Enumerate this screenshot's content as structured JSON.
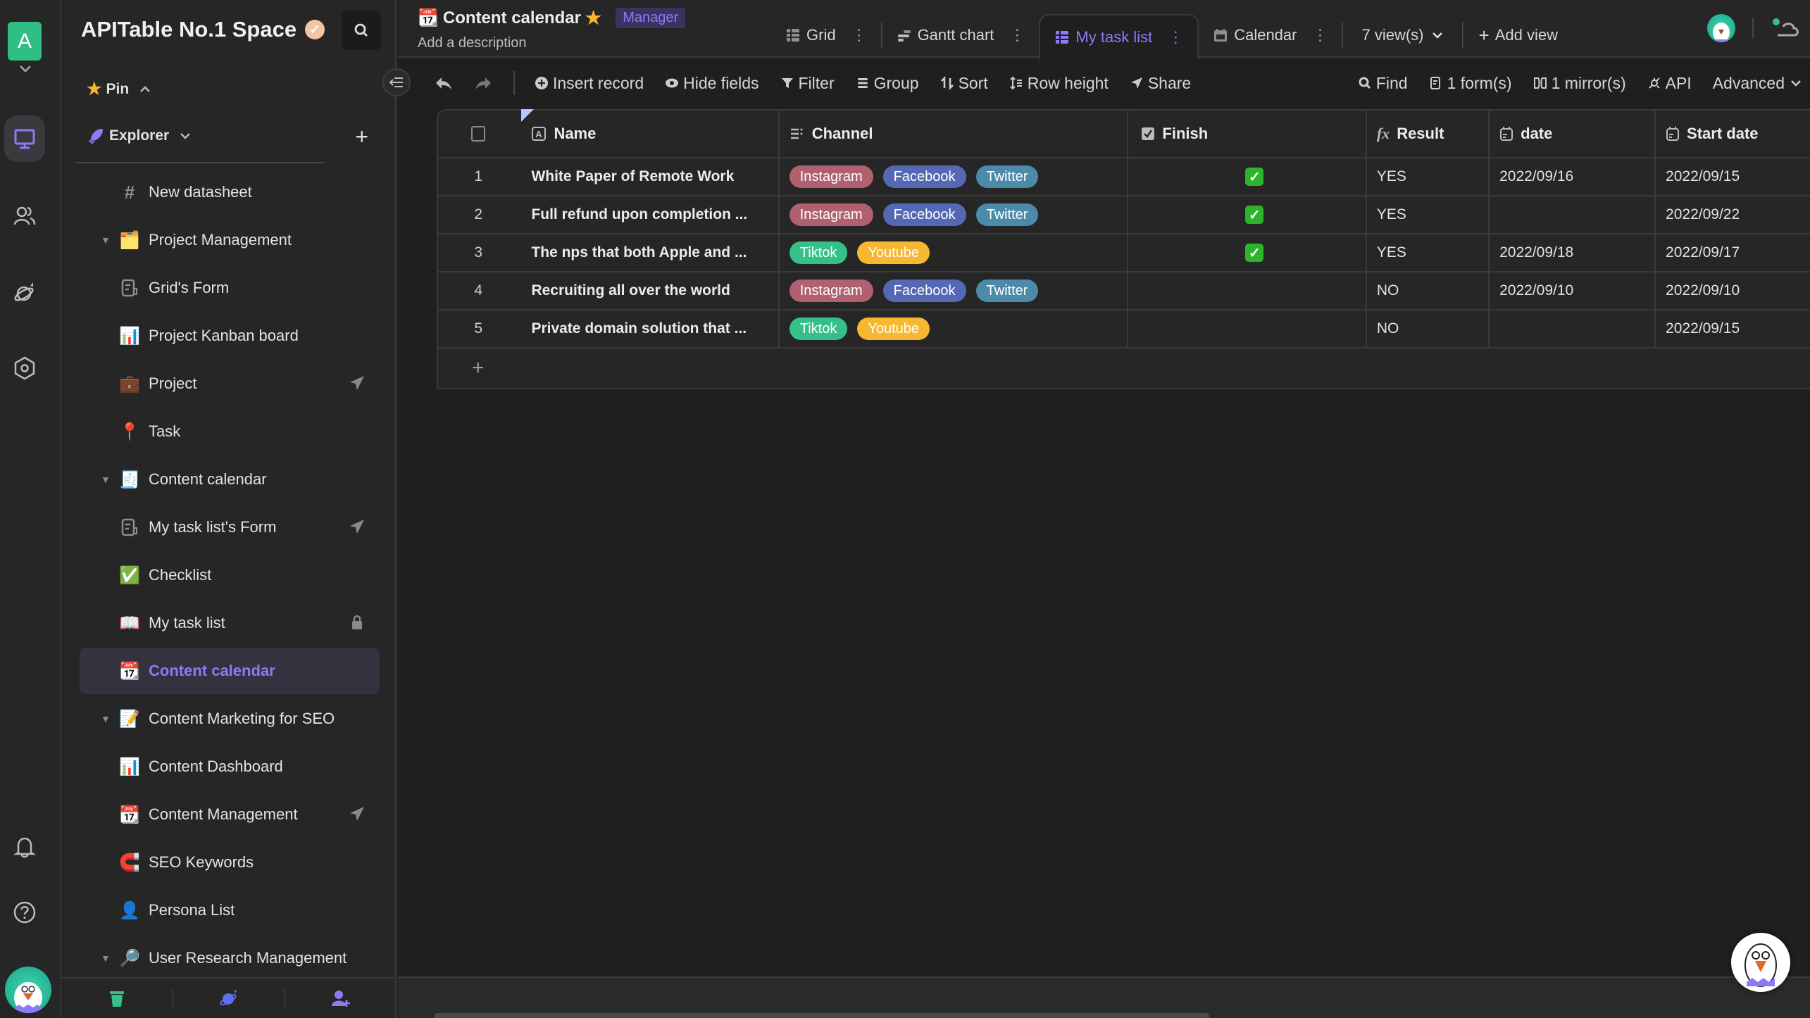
{
  "rail": {
    "space_initial": "A",
    "icons": [
      "workbench-icon",
      "contacts-icon",
      "explore-template-icon",
      "management-icon",
      "notification-icon",
      "help-icon"
    ]
  },
  "sidebar": {
    "space_name": "APITable No.1 Space",
    "pin_label": "Pin",
    "explorer_label": "Explorer",
    "items": [
      {
        "label": "New datasheet",
        "emoji": "#",
        "level": 1,
        "folder": false
      },
      {
        "label": "Project Management",
        "emoji": "🗂️",
        "level": 0,
        "folder": true
      },
      {
        "label": "Grid's Form",
        "emoji": "form",
        "level": 1,
        "folder": false
      },
      {
        "label": "Project Kanban board",
        "emoji": "📊",
        "level": 1,
        "folder": false
      },
      {
        "label": "Project",
        "emoji": "💼",
        "level": 1,
        "folder": false,
        "trail": "share-icon"
      },
      {
        "label": "Task",
        "emoji": "📍",
        "level": 1,
        "folder": false
      },
      {
        "label": "Content calendar",
        "emoji": "🧾",
        "level": 0,
        "folder": true
      },
      {
        "label": "My task list's Form",
        "emoji": "form",
        "level": 1,
        "folder": false,
        "trail": "share-icon"
      },
      {
        "label": "Checklist",
        "emoji": "✅",
        "level": 1,
        "folder": false
      },
      {
        "label": "My task list",
        "emoji": "📖",
        "level": 1,
        "folder": false,
        "trail": "lock-icon"
      },
      {
        "label": "Content calendar",
        "emoji": "📆",
        "level": 1,
        "folder": false,
        "active": true
      },
      {
        "label": "Content Marketing for SEO",
        "emoji": "📝",
        "level": 0,
        "folder": true
      },
      {
        "label": "Content Dashboard",
        "emoji": "📊",
        "level": 1,
        "folder": false
      },
      {
        "label": "Content Management",
        "emoji": "📆",
        "level": 1,
        "folder": false,
        "trail": "share-icon"
      },
      {
        "label": "SEO Keywords",
        "emoji": "🧲",
        "level": 1,
        "folder": false
      },
      {
        "label": "Persona List",
        "emoji": "👤",
        "level": 1,
        "folder": false
      },
      {
        "label": "User Research Management",
        "emoji": "🔎",
        "level": 0,
        "folder": true
      }
    ]
  },
  "header": {
    "title": "Content calendar",
    "title_emoji": "📆",
    "role_badge": "Manager",
    "description_placeholder": "Add a description",
    "tabs": [
      {
        "label": "Grid",
        "icon": "grid-view-icon"
      },
      {
        "label": "Gantt chart",
        "icon": "gantt-view-icon"
      },
      {
        "label": "My task list",
        "icon": "grid-view-icon",
        "active": true
      },
      {
        "label": "Calendar",
        "icon": "calendar-view-icon"
      }
    ],
    "views_count": "7 view(s)",
    "add_view": "Add view"
  },
  "toolbar": {
    "insert_record": "Insert record",
    "hide_fields": "Hide fields",
    "filter": "Filter",
    "group": "Group",
    "sort": "Sort",
    "row_height": "Row height",
    "share": "Share",
    "find": "Find",
    "forms": "1 form(s)",
    "mirrors": "1 mirror(s)",
    "api": "API",
    "advanced": "Advanced"
  },
  "table": {
    "columns": [
      "Name",
      "Channel",
      "Finish",
      "Result",
      "date",
      "Start date"
    ],
    "rows": [
      {
        "index": "1",
        "name": "White Paper of Remote Work",
        "channel": [
          "Instagram",
          "Facebook",
          "Twitter"
        ],
        "finish": true,
        "result": "YES",
        "date": "2022/09/16",
        "start_date": "2022/09/15"
      },
      {
        "index": "2",
        "name": "Full refund upon completion ...",
        "channel": [
          "Instagram",
          "Facebook",
          "Twitter"
        ],
        "finish": true,
        "result": "YES",
        "date": "",
        "start_date": "2022/09/22"
      },
      {
        "index": "3",
        "name": "The nps that both Apple and ...",
        "channel": [
          "Tiktok",
          "Youtube"
        ],
        "finish": true,
        "result": "YES",
        "date": "2022/09/18",
        "start_date": "2022/09/17"
      },
      {
        "index": "4",
        "name": "Recruiting all over the world",
        "channel": [
          "Instagram",
          "Facebook",
          "Twitter"
        ],
        "finish": false,
        "result": "NO",
        "date": "2022/09/10",
        "start_date": "2022/09/10"
      },
      {
        "index": "5",
        "name": "Private domain solution that ...",
        "channel": [
          "Tiktok",
          "Youtube"
        ],
        "finish": false,
        "result": "NO",
        "date": "",
        "start_date": "2022/09/15"
      }
    ],
    "add_row": "+"
  },
  "colors": {
    "accent": "#8b7cf6",
    "tag_instagram": "#b0606e",
    "tag_facebook": "#5468b4",
    "tag_twitter": "#4b8aa8",
    "tag_tiktok": "#35c08a",
    "tag_youtube": "#f7b731",
    "check_green": "#2cb52c"
  }
}
